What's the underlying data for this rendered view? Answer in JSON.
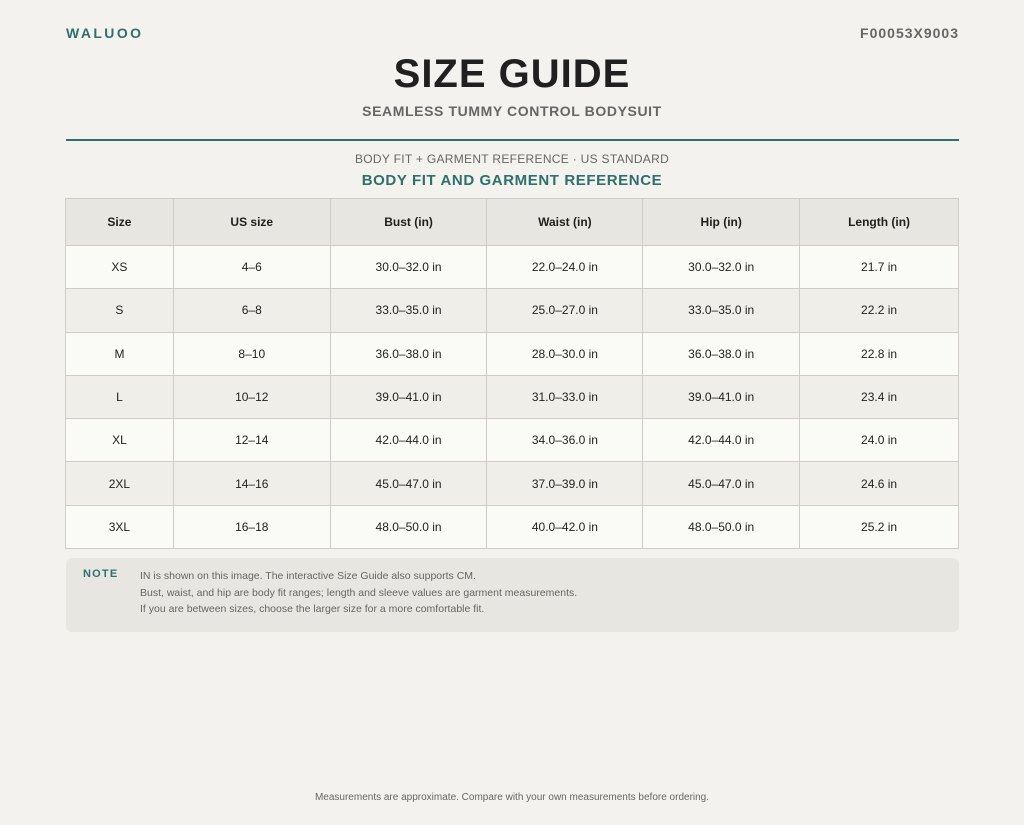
{
  "header": {
    "brand": "WALUOO",
    "sku": "F00053X9003",
    "title": "SIZE GUIDE",
    "subtitle": "SEAMLESS TUMMY CONTROL BODYSUIT",
    "reference_line": "BODY FIT + GARMENT REFERENCE · US STANDARD",
    "section_heading": "BODY FIT AND GARMENT REFERENCE"
  },
  "table": {
    "columns": [
      "Size",
      "US size",
      "Bust (in)",
      "Waist (in)",
      "Hip (in)",
      "Length (in)"
    ],
    "rows": [
      [
        "XS",
        "4–6",
        "30.0–32.0 in",
        "22.0–24.0 in",
        "30.0–32.0 in",
        "21.7 in"
      ],
      [
        "S",
        "6–8",
        "33.0–35.0 in",
        "25.0–27.0 in",
        "33.0–35.0 in",
        "22.2 in"
      ],
      [
        "M",
        "8–10",
        "36.0–38.0 in",
        "28.0–30.0 in",
        "36.0–38.0 in",
        "22.8 in"
      ],
      [
        "L",
        "10–12",
        "39.0–41.0 in",
        "31.0–33.0 in",
        "39.0–41.0 in",
        "23.4 in"
      ],
      [
        "XL",
        "12–14",
        "42.0–44.0 in",
        "34.0–36.0 in",
        "42.0–44.0 in",
        "24.0 in"
      ],
      [
        "2XL",
        "14–16",
        "45.0–47.0 in",
        "37.0–39.0 in",
        "45.0–47.0 in",
        "24.6 in"
      ],
      [
        "3XL",
        "16–18",
        "48.0–50.0 in",
        "40.0–42.0 in",
        "48.0–50.0 in",
        "25.2 in"
      ]
    ]
  },
  "note": {
    "label": "NOTE",
    "lines": [
      "IN is shown on this image. The interactive Size Guide also supports CM.",
      "Bust, waist, and hip are body fit ranges; length and sleeve values are garment measurements.",
      "If you are between sizes, choose the larger size for a more comfortable fit."
    ]
  },
  "footer": "Measurements are approximate. Compare with your own measurements before ordering.",
  "colors": {
    "accent": "#2f6f6c",
    "background": "#f3f2ee",
    "header_row": "#e8e6e0"
  }
}
